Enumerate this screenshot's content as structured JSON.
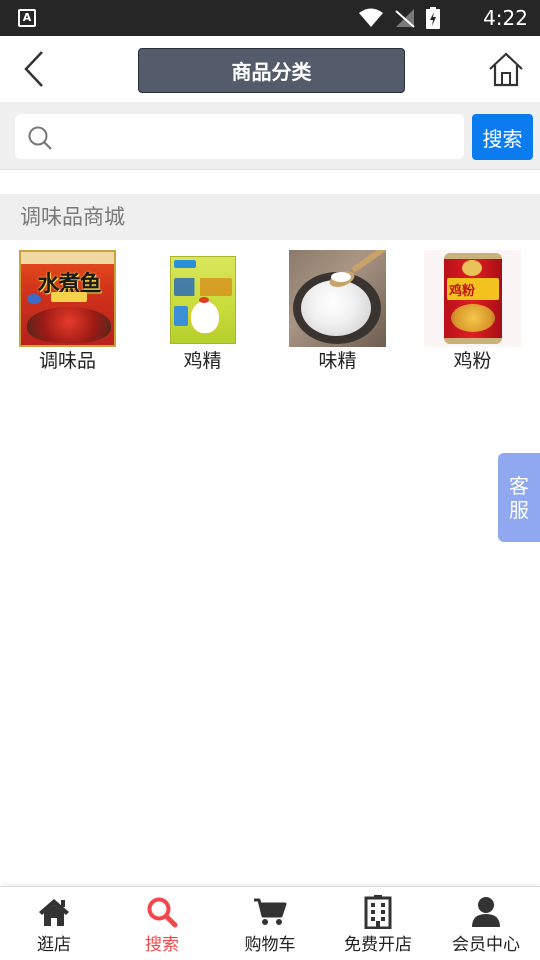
{
  "status_bar": {
    "notification_icon_letter": "A",
    "time": "4:22"
  },
  "header": {
    "title": "商品分类",
    "back_icon": "chevron-left-icon",
    "home_icon": "home-icon"
  },
  "search": {
    "placeholder": "",
    "value": "",
    "button_label": "搜索"
  },
  "section": {
    "title": "调味品商城",
    "categories": [
      {
        "label": "调味品",
        "image_text": "水煮鱼"
      },
      {
        "label": "鸡精"
      },
      {
        "label": "味精"
      },
      {
        "label": "鸡粉",
        "image_text": "鸡粉"
      }
    ]
  },
  "service_tab": {
    "line1": "客",
    "line2": "服"
  },
  "tab_bar": {
    "active_color": "#f2484b",
    "items": [
      {
        "label": "逛店",
        "icon": "home-icon"
      },
      {
        "label": "搜索",
        "icon": "search-icon"
      },
      {
        "label": "购物车",
        "icon": "cart-icon"
      },
      {
        "label": "免费开店",
        "icon": "building-icon"
      },
      {
        "label": "会员中心",
        "icon": "user-icon"
      }
    ]
  }
}
